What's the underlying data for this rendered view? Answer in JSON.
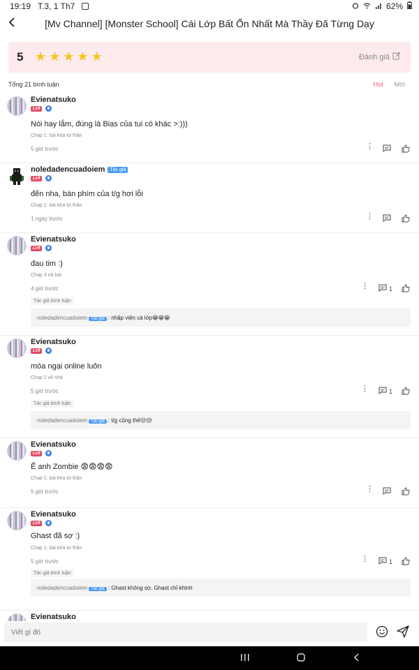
{
  "status": {
    "time": "19:19",
    "date": "T.3, 1 Th7",
    "battery": "62%"
  },
  "header": {
    "title": "[Mv Channel] [Monster School] Cái Lớp Bất Ổn Nhất Mà Thầy Đã Từng Dạy"
  },
  "rating": {
    "score": "5",
    "stars": 5,
    "rate_label": "Đánh giá",
    "star_color": "#f5c51d"
  },
  "comments_header": {
    "total": "Tổng 21 bình luận",
    "sort_hot": "Hot",
    "sort_new": "Mới"
  },
  "comments": [
    {
      "name": "Evienatsuko",
      "level": "Lv9",
      "text": "Nói hay lắm, đúng là Bias của tui có khác >:)))",
      "chap": "Chap 1: bài ktra tứ thần",
      "time": "5 giờ trước"
    },
    {
      "name": "noledadencuadoiem",
      "author_tag": "Tác giả",
      "level": "Lv9",
      "text": "đến nha, bàn phím của t/g hơi lỗi",
      "chap": "Chap 1: bài ktra tứ thần",
      "time": "1 ngày trước"
    },
    {
      "name": "Evienatsuko",
      "level": "Lv9",
      "text": "đau tim :)",
      "chap": "Chap 3 trả bài",
      "time": "4 giờ trước",
      "reply_count": "1",
      "author_comment_label": "Tác giả bình luận",
      "reply": {
        "name": "noledadencuadoiem",
        "tag": "Tác giả",
        "text": ": nhập viện cả lớp😁😁😁"
      }
    },
    {
      "name": "Evienatsuko",
      "level": "Lv9",
      "text": "móa ngại online luôn",
      "chap": "Chap 2 về nhà",
      "time": "5 giờ trước",
      "reply_count": "1",
      "author_comment_label": "Tác giả bình luận",
      "reply": {
        "name": "noledadencuadoiem",
        "tag": "Tác giả",
        "text": ": t/g cũng thế😒😒"
      }
    },
    {
      "name": "Evienatsuko",
      "level": "Lv9",
      "text": "Ế anh Zombie 😨😨😨😨",
      "chap": "Chap 1: bài ktra tứ thần",
      "time": "5 giờ trước"
    },
    {
      "name": "Evienatsuko",
      "level": "Lv9",
      "text": "Ghast đã sợ :)",
      "chap": "Chap 1: bài ktra tứ thần",
      "time": "5 giờ trước",
      "reply_count": "1",
      "author_comment_label": "Tác giả bình luận",
      "reply": {
        "name": "noledadencuadoiem",
        "tag": "Tác giả",
        "text": ": Ghast không sợ, Ghast chỉ khinh"
      }
    },
    {
      "name": "Evienatsuko"
    }
  ],
  "input": {
    "placeholder": "Viết gì đó"
  }
}
